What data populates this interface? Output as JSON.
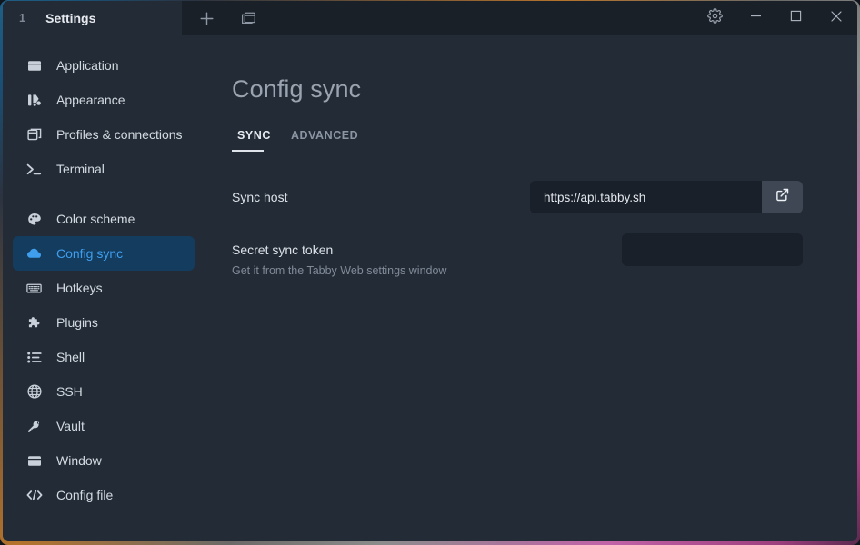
{
  "window": {
    "titlebar": {
      "tab": {
        "index": "1",
        "title": "Settings"
      },
      "new_tab_label": "new-tab",
      "split_label": "toggle-panes",
      "settings_label": "settings",
      "minimize_label": "minimize",
      "maximize_label": "maximize",
      "close_label": "close"
    }
  },
  "sidebar": {
    "groups": [
      {
        "items": [
          {
            "label": "Application",
            "icon": "window-icon",
            "active": false
          },
          {
            "label": "Appearance",
            "icon": "palette-brush-icon",
            "active": false
          },
          {
            "label": "Profiles & connections",
            "icon": "copy-windows-icon",
            "active": false
          },
          {
            "label": "Terminal",
            "icon": "terminal-prompt-icon",
            "active": false
          }
        ]
      },
      {
        "items": [
          {
            "label": "Color scheme",
            "icon": "palette-icon",
            "active": false
          },
          {
            "label": "Config sync",
            "icon": "cloud-icon",
            "active": true
          },
          {
            "label": "Hotkeys",
            "icon": "keyboard-icon",
            "active": false
          },
          {
            "label": "Plugins",
            "icon": "puzzle-piece-icon",
            "active": false
          },
          {
            "label": "Shell",
            "icon": "list-icon",
            "active": false
          },
          {
            "label": "SSH",
            "icon": "globe-icon",
            "active": false
          },
          {
            "label": "Vault",
            "icon": "key-icon",
            "active": false
          },
          {
            "label": "Window",
            "icon": "window-icon",
            "active": false
          },
          {
            "label": "Config file",
            "icon": "code-brackets-icon",
            "active": false
          }
        ]
      }
    ]
  },
  "content": {
    "title": "Config sync",
    "tabs": [
      {
        "label": "SYNC",
        "active": true
      },
      {
        "label": "ADVANCED",
        "active": false
      }
    ],
    "fields": {
      "sync_host": {
        "label": "Sync host",
        "value": "https://api.tabby.sh",
        "placeholder": "",
        "button_icon": "external-link-icon"
      },
      "secret_token": {
        "label": "Secret sync token",
        "description": "Get it from the Tabby Web settings window",
        "value": "",
        "placeholder": ""
      }
    }
  },
  "colors": {
    "accent": "#3f9eee",
    "active_nav_bg": "#133c5e",
    "titlebar_bg": "#1a2028",
    "app_bg": "#232b36",
    "input_bg": "#1a2029",
    "field_button_bg": "#3e4753"
  }
}
